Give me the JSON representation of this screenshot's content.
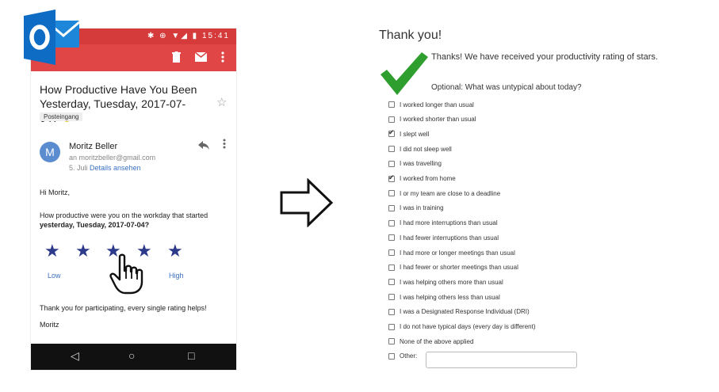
{
  "status_bar": {
    "icons": "✱ ⊕ ▼◢ ▮",
    "time": "15:41"
  },
  "toolbar": {
    "delete_icon": "trash-icon",
    "mail_icon": "envelope-icon",
    "more_icon": "more-vert-icon"
  },
  "email": {
    "subject": "How Productive Have You Been Yesterday, Tuesday, 2017-07-04?",
    "subject_emoji": "☻",
    "label": "Posteingang",
    "sender_initial": "M",
    "sender_name": "Moritz Beller",
    "sender_email": "an moritzbeller@gmail.com",
    "date": "5. Juli",
    "details_link": "Details ansehen",
    "greeting": "Hi Moritz,",
    "question_prefix": "How productive were you on the workday that started",
    "question_date": "yesterday, Tuesday, 2017-07-04?",
    "rating_stars": [
      "★",
      "★",
      "★",
      "★",
      "★"
    ],
    "low_label": "Low",
    "high_label": "High",
    "thanks_line": "Thank you for participating, every single rating helps!",
    "sign_off": "Moritz"
  },
  "nav_bar": {
    "back": "◁",
    "home": "○",
    "recents": "□"
  },
  "form": {
    "title": "Thank you!",
    "thanks_message": "Thanks! We have received your productivity rating of stars.",
    "optional_question": "Optional: What was untypical about today?",
    "options": [
      {
        "label": "I worked longer than usual",
        "checked": false
      },
      {
        "label": "I worked shorter than usual",
        "checked": false
      },
      {
        "label": "I slept well",
        "checked": true
      },
      {
        "label": "I did not sleep well",
        "checked": false
      },
      {
        "label": "I was travelling",
        "checked": false
      },
      {
        "label": "I worked from home",
        "checked": true
      },
      {
        "label": "I or my team are close to a deadline",
        "checked": false
      },
      {
        "label": "I was in training",
        "checked": false
      },
      {
        "label": "I had more interruptions than usual",
        "checked": false
      },
      {
        "label": "I had fewer interruptions than usual",
        "checked": false
      },
      {
        "label": "I had more or longer meetings than usual",
        "checked": false
      },
      {
        "label": "I had fewer or shorter meetings than usual",
        "checked": false
      },
      {
        "label": "I was helping others more than usual",
        "checked": false
      },
      {
        "label": "I was helping others less than usual",
        "checked": false
      },
      {
        "label": "I was a Designated Response Individual (DRI)",
        "checked": false
      },
      {
        "label": "I do not have typical days (every day is different)",
        "checked": false
      },
      {
        "label": "None of the above applied",
        "checked": false
      }
    ],
    "other_label": "Other:",
    "other_value": ""
  },
  "colors": {
    "app_bar": "#e04646",
    "status_bar": "#d63b3b",
    "star": "#2d3a8c",
    "link": "#3a70c2",
    "check_green": "#2e9e2e",
    "outlook_blue": "#0f6cc4"
  }
}
